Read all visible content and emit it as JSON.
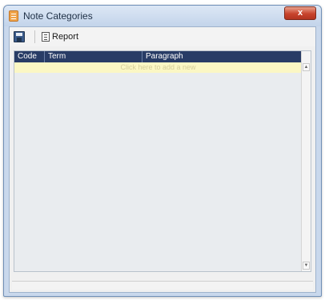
{
  "window": {
    "title": "Note Categories",
    "close_label": "x"
  },
  "toolbar": {
    "report_label": "Report"
  },
  "grid": {
    "columns": [
      "Code",
      "Term",
      "Paragraph"
    ],
    "add_row_text": "Click here to add a new"
  },
  "scrollbar": {
    "up_glyph": "▲",
    "down_glyph": "▼"
  },
  "icons": {
    "app": "note-categories-icon",
    "save": "save-icon",
    "report": "report-icon"
  },
  "colors": {
    "header_bg": "#283c66",
    "add_row_bg": "#fbf7c4",
    "close_button": "#c8442d",
    "window_frame": "#c9d8ec"
  }
}
